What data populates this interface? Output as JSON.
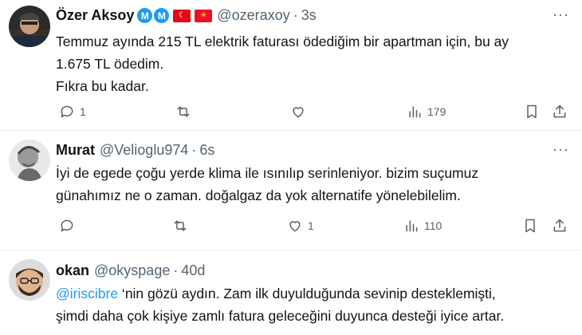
{
  "tweets": [
    {
      "name": "Özer Aksoy",
      "badges": [
        "M",
        "M"
      ],
      "flags": [
        "Turkey",
        "Kyrgyzstan"
      ],
      "handle": "@ozeraxoy",
      "time": "3s",
      "lines": [
        "Temmuz ayında 215 TL elektrik faturası  ödediğim bir apartman için, bu ay",
        "1.675 TL ödedim.",
        "Fıkra bu kadar."
      ],
      "reply_count": "1",
      "retweet_count": "",
      "like_count": "",
      "view_count": "179"
    },
    {
      "name": "Murat",
      "handle": "@Velioglu974",
      "time": "6s",
      "lines": [
        "İyi de egede çoğu yerde klima ile ısınılıp serinleniyor. bizim suçumuz",
        "günahımız ne o zaman. doğalgaz da yok alternatife yönelebilelim."
      ],
      "reply_count": "",
      "retweet_count": "",
      "like_count": "1",
      "view_count": "110"
    },
    {
      "name": "okan",
      "handle": "@okyspage",
      "time": "40d",
      "mention": "@iriscibre",
      "line1_rest": " ‘nin gözü aydın. Zam ilk duyulduğunda sevinip desteklemişti,",
      "line2": "şimdi daha çok kişiye zamlı fatura geleceğini duyunca desteği iyice artar."
    }
  ],
  "icons": {
    "reply": "reply-icon",
    "retweet": "retweet-icon",
    "like": "heart-icon",
    "views": "views-icon",
    "bookmark": "bookmark-icon",
    "share": "share-icon",
    "more": "more-icon"
  },
  "colors": {
    "verified": "#1d9bf0",
    "secondary_text": "#536471",
    "mention": "#1d9bf0"
  }
}
